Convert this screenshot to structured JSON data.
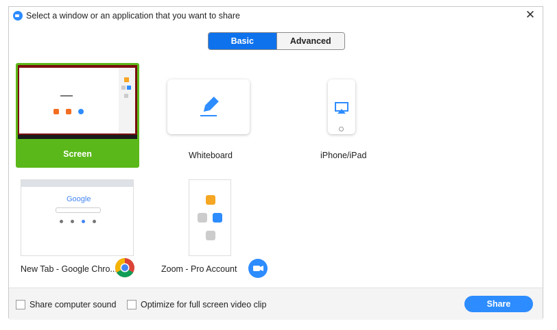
{
  "window": {
    "title": "Select a window or an application that you want to share",
    "close_glyph": "✕"
  },
  "tabs": [
    {
      "label": "Basic",
      "active": true
    },
    {
      "label": "Advanced",
      "active": false
    }
  ],
  "tiles": {
    "screen": {
      "label": "Screen",
      "selected": true
    },
    "whiteboard": {
      "label": "Whiteboard"
    },
    "iphone": {
      "label": "iPhone/iPad"
    },
    "chrome": {
      "label": "New Tab - Google Chro..."
    },
    "zoom": {
      "label": "Zoom - Pro Account"
    }
  },
  "chrome_thumb": {
    "logo_text": "Google"
  },
  "footer": {
    "share_sound": {
      "label": "Share computer sound",
      "checked": false
    },
    "optimize": {
      "label": "Optimize for full screen video clip",
      "checked": false
    },
    "share_button": "Share"
  },
  "colors": {
    "accent": "#2d8cff",
    "tab_active": "#0e72ed",
    "selected_tile": "#5bb81a"
  },
  "icons": [
    "zoom-logo-icon",
    "close-icon",
    "pencil-icon",
    "airplay-icon",
    "chrome-icon",
    "zoom-camera-icon"
  ]
}
